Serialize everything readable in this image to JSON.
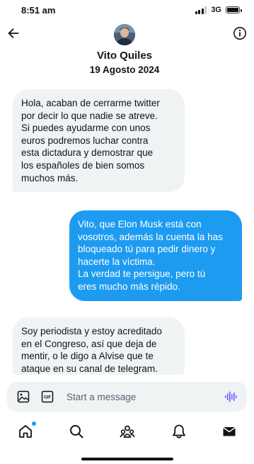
{
  "status_bar": {
    "time": "8:51 am",
    "network": "3G"
  },
  "header": {
    "contact_name": "Vito Quiles",
    "date": "19 Agosto 2024",
    "back_icon": "arrow-left-icon",
    "info_icon": "info-icon"
  },
  "messages": [
    {
      "direction": "incoming",
      "text": "Hola, acaban de cerrarme twitter\npor decir lo que nadie se atreve.\nSi puedes ayudarme con unos\neuros podremos luchar contra\nesta dictadura y demostrar que\nlos españoles de bien somos\nmuchos más."
    },
    {
      "direction": "outgoing",
      "text": "Vito, que Elon Musk está con\nvosotros, además la cuenta la has\nbloqueado tú para pedir dinero y\nhacerte la víctima.\nLa verdad te persigue, pero tú\neres mucho más répido."
    },
    {
      "direction": "incoming",
      "text": "Soy periodista y estoy acreditado\nen el Congreso, así que deja de\nmentir, o le digo a Alvise que te\nataque en su canal de telegram."
    }
  ],
  "composer": {
    "placeholder": "Start a message",
    "value": "",
    "image_icon": "image-icon",
    "gif_icon": "gif-icon",
    "voice_icon": "voice-waveform-icon"
  },
  "nav": {
    "items": [
      "home-icon",
      "search-icon",
      "communities-icon",
      "notifications-icon",
      "messages-icon"
    ]
  },
  "colors": {
    "accent": "#1d9bf0",
    "incoming_bubble": "#eff3f4",
    "text": "#0f1419"
  }
}
